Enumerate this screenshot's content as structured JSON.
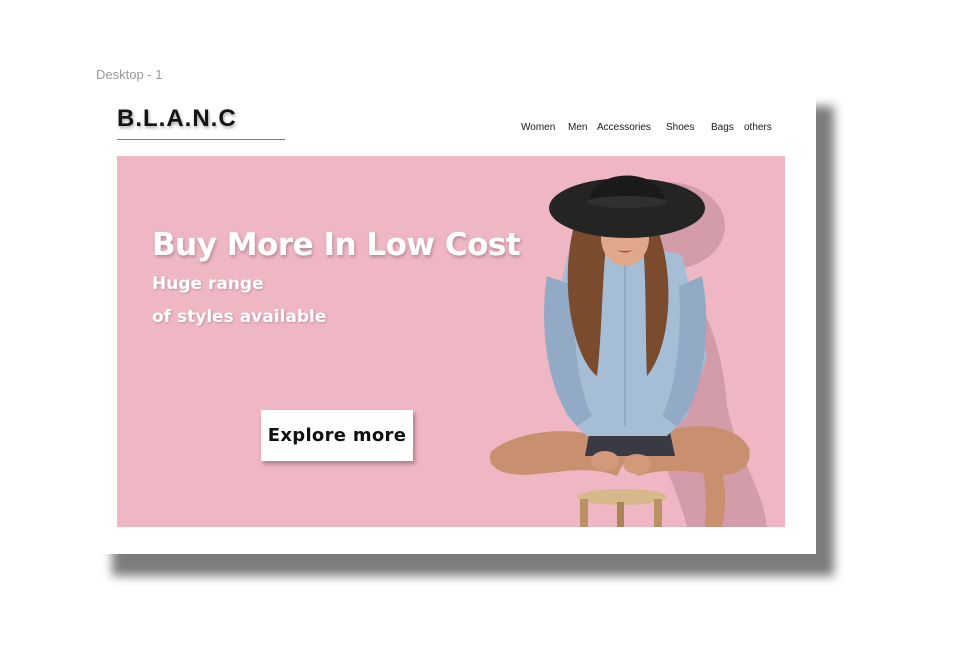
{
  "frame": {
    "label": "Desktop - 1"
  },
  "brand": {
    "logo": "B.L.A.N.C"
  },
  "nav": {
    "items": [
      "Women",
      "Men",
      "Accessories",
      "Shoes",
      "Bags",
      "others"
    ]
  },
  "hero": {
    "title": "Buy More In Low Cost",
    "subtitle_line1": "Huge range",
    "subtitle_line2": "of styles available",
    "button_label": "Explore  more",
    "image": "woman-in-black-hat-sitting-on-stool"
  },
  "colors": {
    "hero_background": "#efb6c3",
    "text_dark": "#141414",
    "text_light": "#ffffff"
  }
}
